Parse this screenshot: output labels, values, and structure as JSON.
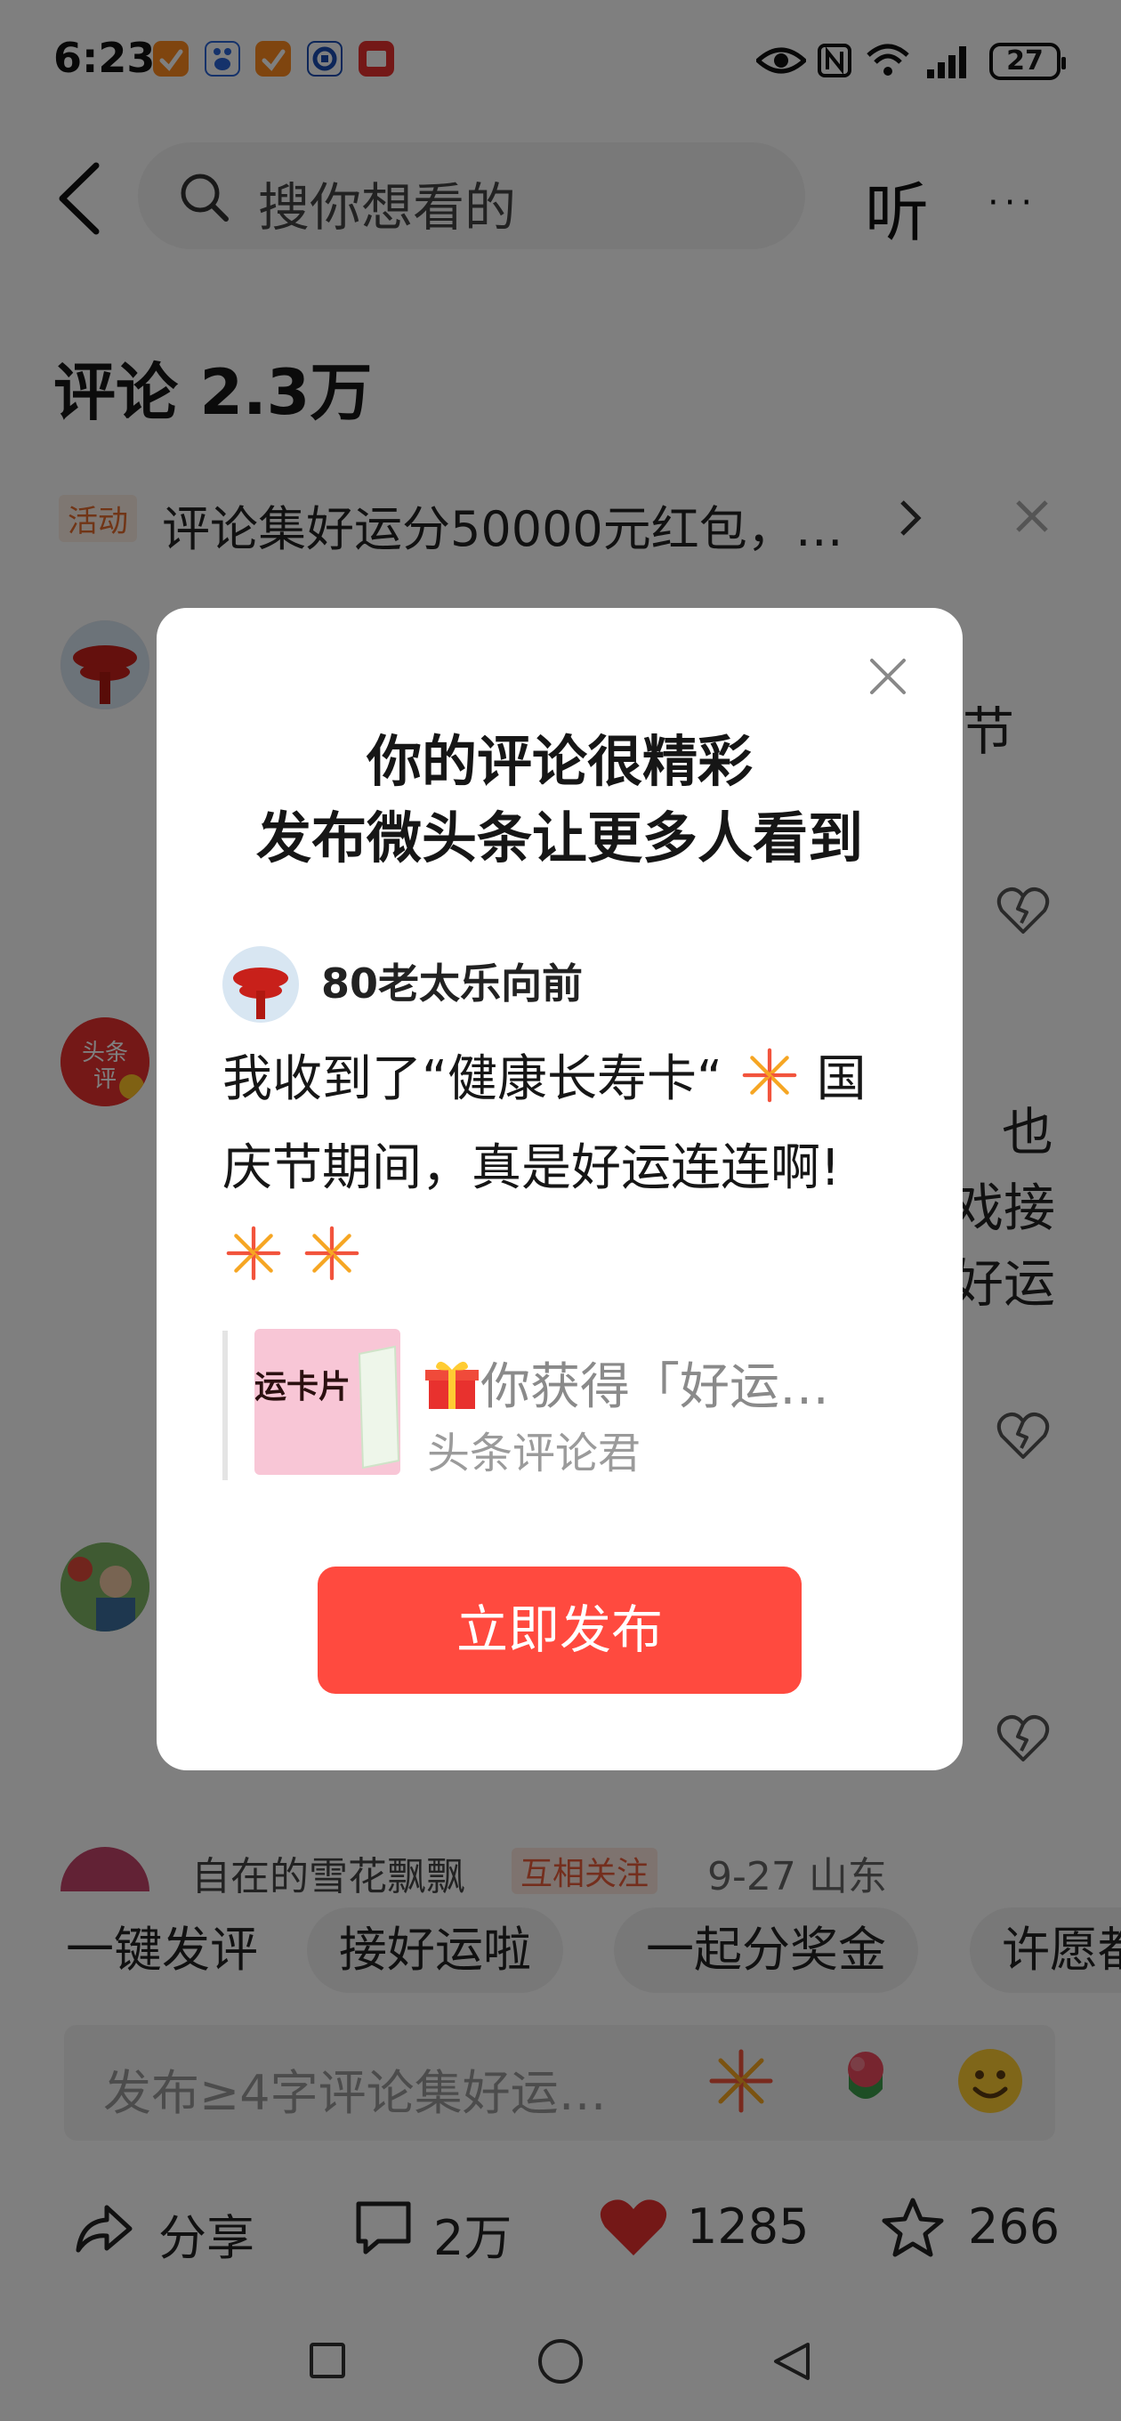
{
  "status_bar": {
    "time": "6:23",
    "battery": "27",
    "app_icons": [
      "taobao-icon",
      "baidu-icon",
      "taobao-icon",
      "bank-icon",
      "mail-icon"
    ],
    "status_icons": [
      "eye-icon",
      "nfc-icon",
      "wifi-icon",
      "signal-icon",
      "battery-icon"
    ]
  },
  "header": {
    "search_placeholder": "搜你想看的",
    "listen_label": "听",
    "more_label": "···"
  },
  "comments_section": {
    "title": "评论 2.3万",
    "activity": {
      "tag": "活动",
      "text": "评论集好运分50000元红包，…"
    },
    "visible_fragments": [
      "节",
      "也",
      "戏接",
      "好运"
    ],
    "last_comment": {
      "user": "自在的雪花飘飘",
      "badge": "互相关注",
      "date": "9-27 山东"
    }
  },
  "quick_replies": [
    "一键发评",
    "接好运啦",
    "一起分奖金",
    "许愿都"
  ],
  "comment_input": {
    "placeholder": "发布≥4字评论集好运…"
  },
  "actions": {
    "share_label": "分享",
    "comments_count": "2万",
    "likes_count": "1285",
    "favorites_count": "266"
  },
  "dialog": {
    "title_line1": "你的评论很精彩",
    "title_line2": "发布微头条让更多人看到",
    "username": "80老太乐向前",
    "body_line1": "我收到了“健康长寿卡“",
    "body_line1_tail": "国",
    "body_line2": "庆节期间，真是好运连连啊!",
    "card_thumb_text": "运卡片",
    "card_text": "你获得「好运…",
    "card_author": "头条评论君",
    "button_label": "立即发布"
  },
  "colors": {
    "accent_red": "#ff4a3f",
    "activity_orange": "#e26a2c",
    "like_red": "#e8312e",
    "scrim": "rgba(0,0,0,0.5)"
  }
}
